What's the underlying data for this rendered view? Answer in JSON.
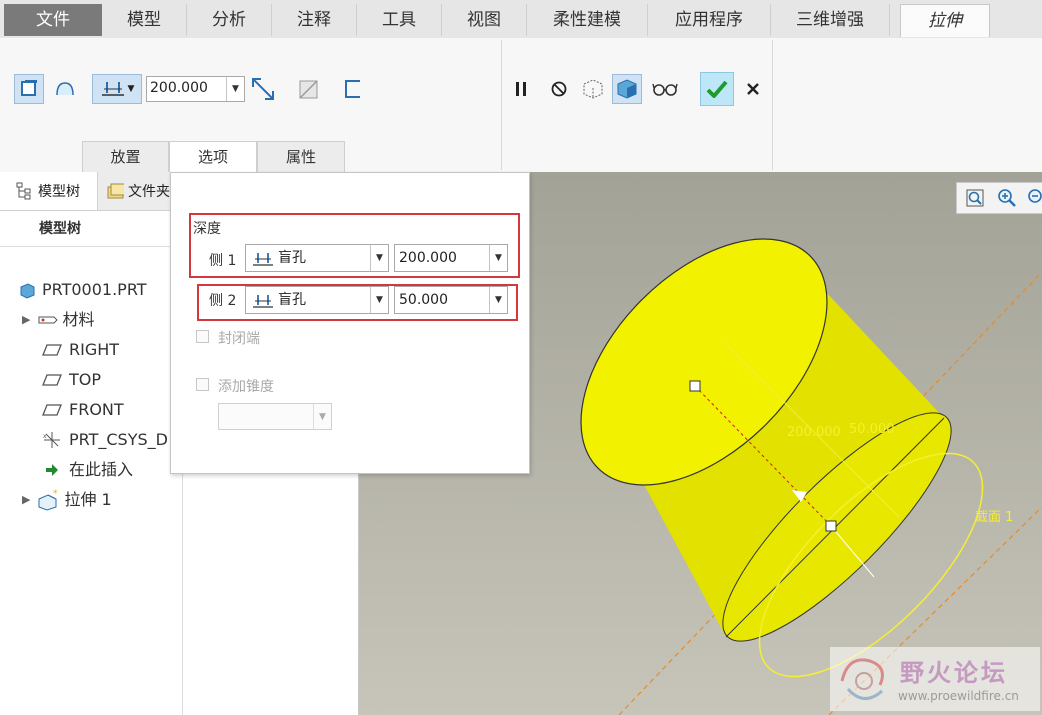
{
  "menu": {
    "tabs": [
      "文件",
      "模型",
      "分析",
      "注释",
      "工具",
      "视图",
      "柔性建模",
      "应用程序",
      "三维增强"
    ],
    "active_feature_tab": "拉伸"
  },
  "ribbon": {
    "depth_value": "200.000",
    "subtabs": [
      "放置",
      "选项",
      "属性"
    ],
    "icons": [
      "solid-icon",
      "surface-icon",
      "depth-blind-icon",
      "flip-direction-icon",
      "remove-material-icon",
      "thicken-icon",
      "pause-icon",
      "no-preview-icon",
      "preview-icon",
      "verify-icon",
      "glasses-icon",
      "confirm-check-icon",
      "cancel-x-icon"
    ]
  },
  "left_panel": {
    "tabs": [
      "模型树",
      "文件夹"
    ],
    "tree_header": "模型树",
    "items": [
      "PRT0001.PRT",
      "材料",
      "RIGHT",
      "TOP",
      "FRONT",
      "PRT_CSYS_D",
      "在此插入",
      "拉伸 1"
    ]
  },
  "options": {
    "depth_label": "深度",
    "side1_label": "侧 1",
    "side1_type": "盲孔",
    "side1_value": "200.000",
    "side2_label": "侧 2",
    "side2_type": "盲孔",
    "side2_value": "50.000",
    "capped_label": "封闭端",
    "taper_label": "添加锥度"
  },
  "viewport": {
    "dim1": "200.000",
    "dim2": "50.000",
    "section_label": "截面 1",
    "watermark_title": "野火论坛",
    "watermark_url": "www.proewildfire.cn"
  },
  "colors": {
    "accent_red": "#d3383d",
    "model_yellow": "#e8e600",
    "confirm_bg": "#bde6f6"
  }
}
